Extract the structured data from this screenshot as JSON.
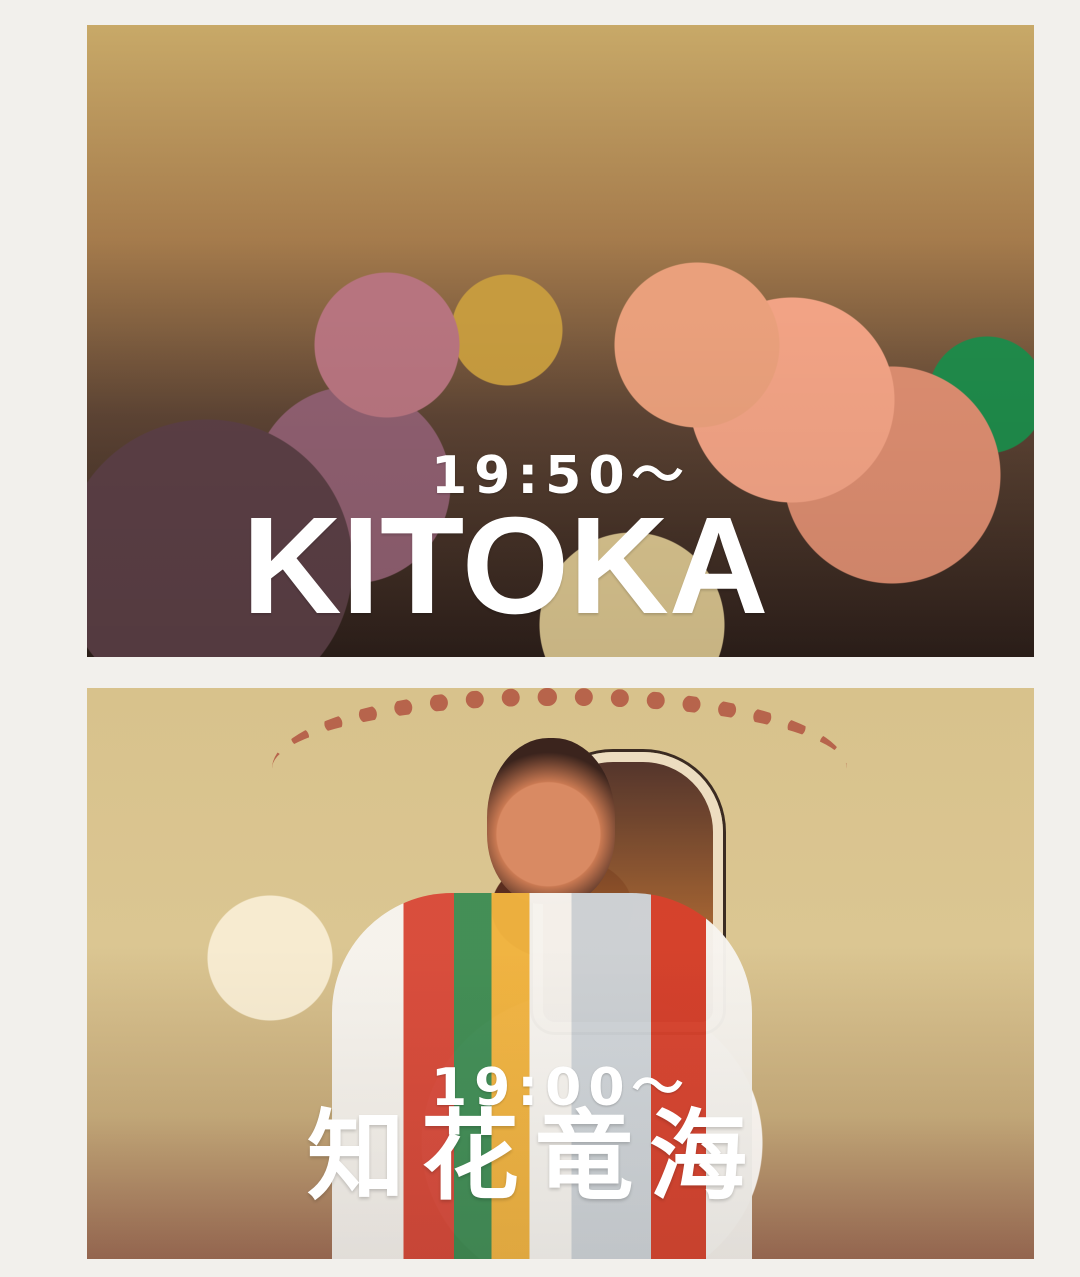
{
  "panels": [
    {
      "time": "19:50〜",
      "artist": "KITOKA"
    },
    {
      "time": "19:00〜",
      "artist": "知花竜海"
    }
  ]
}
